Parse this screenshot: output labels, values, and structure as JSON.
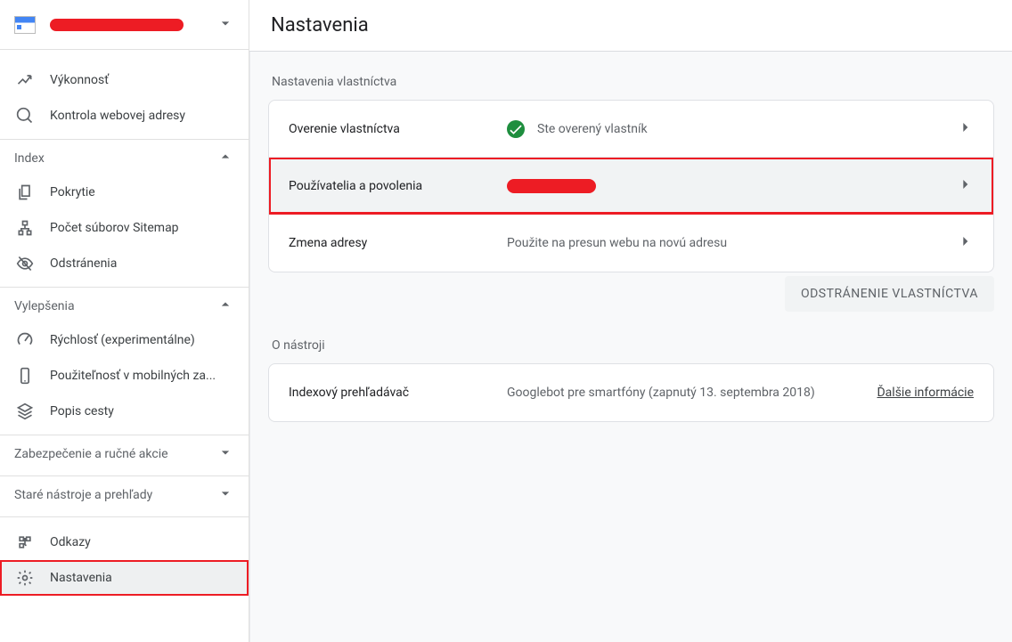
{
  "sidebar": {
    "items_top": [
      {
        "icon": "trend",
        "label": "Výkonnosť"
      },
      {
        "icon": "search",
        "label": "Kontrola webovej adresy"
      }
    ],
    "section_index": {
      "label": "Index",
      "expanded": true,
      "items": [
        {
          "icon": "copy",
          "label": "Pokrytie"
        },
        {
          "icon": "sitemap",
          "label": "Počet súborov Sitemap"
        },
        {
          "icon": "hide",
          "label": "Odstránenia"
        }
      ]
    },
    "section_enhance": {
      "label": "Vylepšenia",
      "expanded": true,
      "items": [
        {
          "icon": "speed",
          "label": "Rýchlosť (experimentálne)"
        },
        {
          "icon": "mobile",
          "label": "Použiteľnosť v mobilných za..."
        },
        {
          "icon": "breadcrumb",
          "label": "Popis cesty"
        }
      ]
    },
    "section_security": {
      "label": "Zabezpečenie a ručné akcie",
      "expanded": false
    },
    "section_legacy": {
      "label": "Staré nástroje a prehľady",
      "expanded": false
    },
    "items_bottom": [
      {
        "icon": "links",
        "label": "Odkazy"
      },
      {
        "icon": "gear",
        "label": "Nastavenia",
        "selected": true
      }
    ]
  },
  "main": {
    "title": "Nastavenia",
    "section_property": "Nastavenia vlastníctva",
    "rows": {
      "verify": {
        "title": "Overenie vlastníctva",
        "status": "Ste overený vlastník"
      },
      "users": {
        "title": "Používatelia a povolenia"
      },
      "move": {
        "title": "Zmena adresy",
        "status": "Použite na presun webu na novú adresu"
      }
    },
    "remove_btn": "Odstránenie vlastníctva",
    "section_about": "O nástroji",
    "crawler": {
      "title": "Indexový prehľadávač",
      "status": "Googlebot pre smartfóny (zapnutý 13. septembra 2018)",
      "link": "Ďalšie informácie"
    }
  }
}
